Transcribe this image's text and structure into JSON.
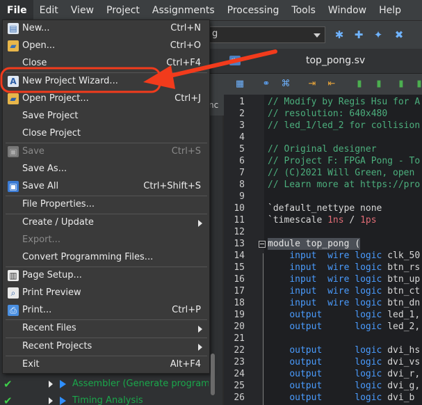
{
  "menubar": {
    "items": [
      "File",
      "Edit",
      "View",
      "Project",
      "Assignments",
      "Processing",
      "Tools",
      "Window",
      "Help"
    ]
  },
  "toolbar": {
    "combo_value": "g"
  },
  "editor_tab": {
    "title": "top_pong.sv",
    "icon_text": "abc"
  },
  "side_strip_text": "nc",
  "file_menu": {
    "items": [
      {
        "label": "New...",
        "shortcut": "Ctrl+N",
        "icon": "new-file-icon",
        "enabled": true
      },
      {
        "label": "Open...",
        "shortcut": "Ctrl+O",
        "icon": "open-folder-icon",
        "enabled": true
      },
      {
        "label": "Close",
        "shortcut": "Ctrl+F4",
        "enabled": true
      },
      {
        "label": "New Project Wizard...",
        "icon": "wizard-icon",
        "enabled": true
      },
      {
        "label": "Open Project...",
        "shortcut": "Ctrl+J",
        "icon": "open-project-icon",
        "enabled": true
      },
      {
        "label": "Save Project",
        "enabled": true
      },
      {
        "label": "Close Project",
        "enabled": true
      },
      {
        "label": "Save",
        "shortcut": "Ctrl+S",
        "icon": "save-icon",
        "enabled": false
      },
      {
        "label": "Save As...",
        "enabled": true
      },
      {
        "label": "Save All",
        "shortcut": "Ctrl+Shift+S",
        "icon": "save-all-icon",
        "enabled": true
      },
      {
        "label": "File Properties...",
        "enabled": true
      },
      {
        "label": "Create / Update",
        "submenu": true,
        "enabled": true
      },
      {
        "label": "Export...",
        "enabled": false
      },
      {
        "label": "Convert Programming Files...",
        "enabled": true
      },
      {
        "label": "Page Setup...",
        "icon": "page-setup-icon",
        "enabled": true
      },
      {
        "label": "Print Preview",
        "icon": "print-preview-icon",
        "enabled": true
      },
      {
        "label": "Print...",
        "shortcut": "Ctrl+P",
        "icon": "print-icon",
        "enabled": true
      },
      {
        "label": "Recent Files",
        "submenu": true,
        "enabled": true
      },
      {
        "label": "Recent Projects",
        "submenu": true,
        "enabled": true
      },
      {
        "label": "Exit",
        "shortcut": "Alt+F4",
        "enabled": true
      }
    ]
  },
  "tasks": [
    {
      "label": "Assembler (Generate programmi"
    },
    {
      "label": "Timing Analysis"
    }
  ],
  "code": {
    "line_numbers": [
      "1",
      "2",
      "3",
      "4",
      "5",
      "6",
      "7",
      "8",
      "9",
      "10",
      "11",
      "12",
      "13",
      "14",
      "15",
      "16",
      "17",
      "18",
      "19",
      "20",
      "21",
      "22",
      "23",
      "24",
      "25",
      "26"
    ],
    "comment1": "// Modify by Regis Hsu for A",
    "comment2": "// resolution: 640x480",
    "comment3": "// led_1/led_2 for collision",
    "comment5": "// Original designer",
    "comment6": "// Project F: FPGA Pong - To",
    "comment7": "// (C)2021 Will Green, open",
    "comment8": "// Learn more at https://pro",
    "line10": "`default_nettype none",
    "line11_a": "`timescale ",
    "line11_b": "1ns",
    "line11_c": " / ",
    "line11_d": "1ps",
    "line13": "module top_pong (",
    "kw_input": "input",
    "kw_output": "output",
    "kw_wire": "wire",
    "kw_logic": "logic",
    "sig14": "clk_50",
    "sig15": "btn_rs",
    "sig16": "btn_up",
    "sig17": "btn_ct",
    "sig18": "btn_dn",
    "sig19": "led_1,",
    "sig20": "led_2,",
    "sig22": "dvi_hs",
    "sig23": "dvi_vs",
    "sig24": "dvi_r,",
    "sig25": "dvi_g,",
    "sig26": "dvi_b"
  },
  "colors": {
    "annotation_arrow": "#f23b1c",
    "comment": "#4caf7d",
    "keyword": "#4a9cff",
    "number": "#e06c75"
  }
}
